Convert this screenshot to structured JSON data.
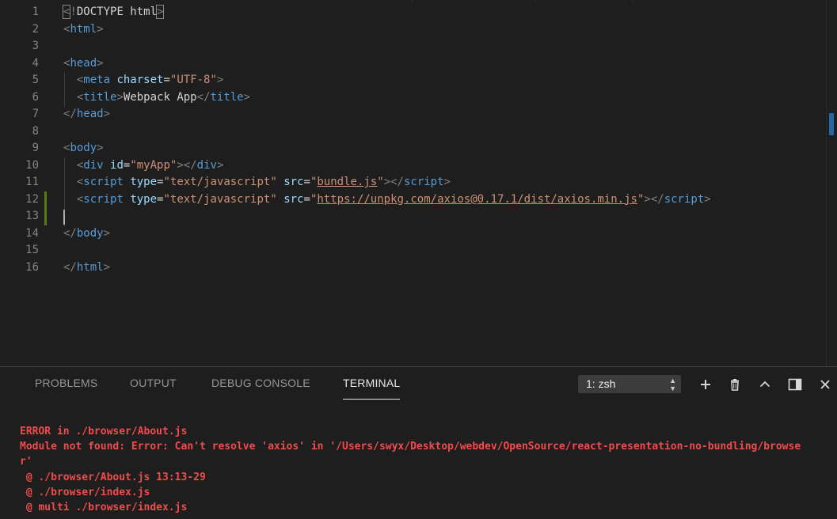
{
  "editor": {
    "lines": [
      {
        "n": "1",
        "tokens": [
          [
            "punc-box",
            "<"
          ],
          [
            "punc",
            "!"
          ],
          [
            "text",
            "DOCTYPE html"
          ],
          [
            "punc-box",
            ">"
          ]
        ]
      },
      {
        "n": "2",
        "tokens": [
          [
            "punc",
            "<"
          ],
          [
            "tag",
            "html"
          ],
          [
            "punc",
            ">"
          ]
        ]
      },
      {
        "n": "3",
        "tokens": []
      },
      {
        "n": "4",
        "tokens": [
          [
            "punc",
            "<"
          ],
          [
            "tag",
            "head"
          ],
          [
            "punc",
            ">"
          ]
        ]
      },
      {
        "n": "5",
        "tokens": [
          [
            "text",
            "  "
          ],
          [
            "punc",
            "<"
          ],
          [
            "tag",
            "meta"
          ],
          [
            "text",
            " "
          ],
          [
            "attr",
            "charset"
          ],
          [
            "text",
            "="
          ],
          [
            "str",
            "\"UTF-8\""
          ],
          [
            "punc",
            ">"
          ]
        ]
      },
      {
        "n": "6",
        "tokens": [
          [
            "text",
            "  "
          ],
          [
            "punc",
            "<"
          ],
          [
            "tag",
            "title"
          ],
          [
            "punc",
            ">"
          ],
          [
            "text",
            "Webpack App"
          ],
          [
            "punc",
            "</"
          ],
          [
            "tag",
            "title"
          ],
          [
            "punc",
            ">"
          ]
        ]
      },
      {
        "n": "7",
        "tokens": [
          [
            "punc",
            "</"
          ],
          [
            "tag",
            "head"
          ],
          [
            "punc",
            ">"
          ]
        ]
      },
      {
        "n": "8",
        "tokens": []
      },
      {
        "n": "9",
        "tokens": [
          [
            "punc",
            "<"
          ],
          [
            "tag",
            "body"
          ],
          [
            "punc",
            ">"
          ]
        ]
      },
      {
        "n": "10",
        "tokens": [
          [
            "text",
            "  "
          ],
          [
            "punc",
            "<"
          ],
          [
            "tag",
            "div"
          ],
          [
            "text",
            " "
          ],
          [
            "attr",
            "id"
          ],
          [
            "text",
            "="
          ],
          [
            "str",
            "\"myApp\""
          ],
          [
            "punc",
            "></"
          ],
          [
            "tag",
            "div"
          ],
          [
            "punc",
            ">"
          ]
        ]
      },
      {
        "n": "11",
        "tokens": [
          [
            "text",
            "  "
          ],
          [
            "punc",
            "<"
          ],
          [
            "tag",
            "script"
          ],
          [
            "text",
            " "
          ],
          [
            "attr",
            "type"
          ],
          [
            "text",
            "="
          ],
          [
            "str",
            "\"text/javascript\""
          ],
          [
            "text",
            " "
          ],
          [
            "attr",
            "src"
          ],
          [
            "text",
            "="
          ],
          [
            "str",
            "\""
          ],
          [
            "link",
            "bundle.js"
          ],
          [
            "str",
            "\""
          ],
          [
            "punc",
            "></"
          ],
          [
            "tag",
            "script"
          ],
          [
            "punc",
            ">"
          ]
        ]
      },
      {
        "n": "12",
        "tokens": [
          [
            "text",
            "  "
          ],
          [
            "punc",
            "<"
          ],
          [
            "tag",
            "script"
          ],
          [
            "text",
            " "
          ],
          [
            "attr",
            "type"
          ],
          [
            "text",
            "="
          ],
          [
            "str",
            "\"text/javascript\""
          ],
          [
            "text",
            " "
          ],
          [
            "attr",
            "src"
          ],
          [
            "text",
            "="
          ],
          [
            "str",
            "\""
          ],
          [
            "link",
            "https://unpkg.com/axios@0.17.1/dist/axios.min.js"
          ],
          [
            "str",
            "\""
          ],
          [
            "punc",
            "></"
          ],
          [
            "tag",
            "script"
          ],
          [
            "punc",
            ">"
          ]
        ]
      },
      {
        "n": "13",
        "tokens": []
      },
      {
        "n": "14",
        "tokens": [
          [
            "punc",
            "</"
          ],
          [
            "tag",
            "body"
          ],
          [
            "punc",
            ">"
          ]
        ]
      },
      {
        "n": "15",
        "tokens": []
      },
      {
        "n": "16",
        "tokens": [
          [
            "punc",
            "</"
          ],
          [
            "tag",
            "html"
          ],
          [
            "punc",
            ">"
          ]
        ]
      }
    ]
  },
  "panel": {
    "tabs": {
      "problems": "PROBLEMS",
      "output": "OUTPUT",
      "debug_console": "DEBUG CONSOLE",
      "terminal": "TERMINAL"
    },
    "active_tab": "terminal",
    "terminal_select": "1: zsh",
    "icons": [
      "plus-icon",
      "trash-icon",
      "chevron-up-icon",
      "split-panel-icon",
      "close-icon"
    ],
    "terminal_lines": [
      "ERROR in ./browser/About.js",
      "Module not found: Error: Can't resolve 'axios' in '/Users/swyx/Desktop/webdev/OpenSource/react-presentation-no-bundling/browse",
      "r'",
      " @ ./browser/About.js 13:13-29",
      " @ ./browser/index.js",
      " @ multi ./browser/index.js"
    ]
  },
  "colors": {
    "background": "#1e1e1e",
    "tag": "#569cd6",
    "attribute": "#9cdcfe",
    "string": "#ce9178",
    "error": "#f14c4c",
    "git_added": "#587c0c"
  }
}
